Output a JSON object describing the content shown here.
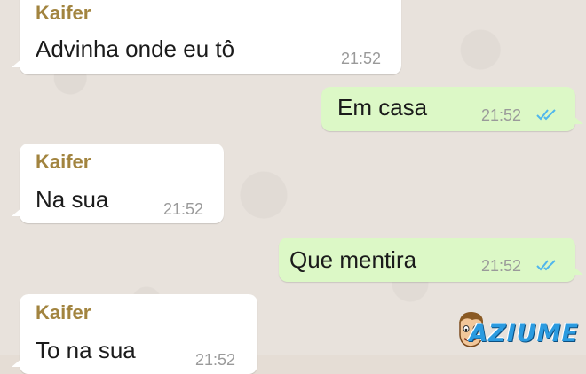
{
  "chat": {
    "messages": [
      {
        "direction": "incoming",
        "sender": "Kaifer",
        "text": "Advinha onde eu tô",
        "time": "21:52"
      },
      {
        "direction": "outgoing",
        "text": "Em casa",
        "time": "21:52",
        "status": "read"
      },
      {
        "direction": "incoming",
        "sender": "Kaifer",
        "text": "Na sua",
        "time": "21:52"
      },
      {
        "direction": "outgoing",
        "text": "Que mentira",
        "time": "21:52",
        "status": "read"
      },
      {
        "direction": "incoming",
        "sender": "Kaifer",
        "text": "To na sua",
        "time": "21:52"
      }
    ]
  },
  "colors": {
    "incoming_bubble": "#ffffff",
    "outgoing_bubble": "#dcf8c6",
    "sender_name": "#a2843f",
    "read_ticks": "#4fb6ec",
    "background": "#e5ddd5"
  },
  "watermark": {
    "text": "AZIUME",
    "icon": "mascot-face-icon"
  }
}
